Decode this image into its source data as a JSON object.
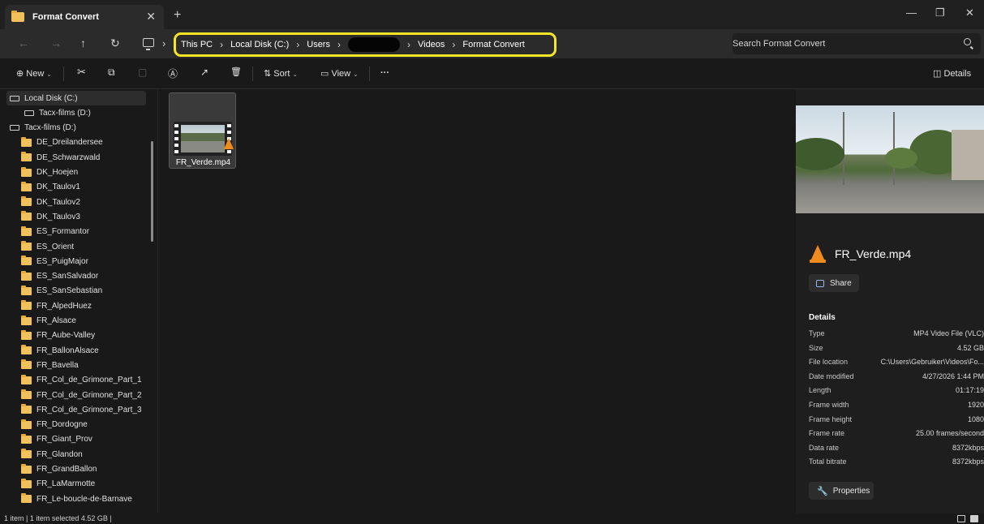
{
  "tab": {
    "title": "Format Convert",
    "close": "✕",
    "add": "+"
  },
  "window_controls": {
    "minimize": "—",
    "maximize": "❐",
    "close": "✕"
  },
  "nav": {
    "back": "←",
    "forward": "→",
    "up": "↑",
    "refresh": "↻",
    "sep": "›"
  },
  "breadcrumb": {
    "items": [
      "This PC",
      "Local Disk (C:)",
      "Users",
      "Videos",
      "Format Convert"
    ],
    "sep": "›"
  },
  "search": {
    "placeholder": "Search Format Convert"
  },
  "commands": {
    "new": "New",
    "sort": "Sort",
    "view": "View",
    "more": "···",
    "details": "Details",
    "cut_icon": "✂",
    "copy_icon": "⧉",
    "paste_icon": "▢",
    "rename_icon": "Ⓐ",
    "share_icon": "↗",
    "delete_icon": "🗑"
  },
  "sidebar": {
    "items": [
      {
        "label": "Local Disk (C:)",
        "kind": "drive"
      },
      {
        "label": "Tacx-films (D:)",
        "kind": "drive"
      },
      {
        "label": "Tacx-films (D:)",
        "kind": "drive"
      },
      {
        "label": "DE_Dreilandersee",
        "kind": "folder"
      },
      {
        "label": "DE_Schwarzwald",
        "kind": "folder"
      },
      {
        "label": "DK_Hoejen",
        "kind": "folder"
      },
      {
        "label": "DK_Taulov1",
        "kind": "folder"
      },
      {
        "label": "DK_Taulov2",
        "kind": "folder"
      },
      {
        "label": "DK_Taulov3",
        "kind": "folder"
      },
      {
        "label": "ES_Formantor",
        "kind": "folder"
      },
      {
        "label": "ES_Orient",
        "kind": "folder"
      },
      {
        "label": "ES_PuigMajor",
        "kind": "folder"
      },
      {
        "label": "ES_SanSalvador",
        "kind": "folder"
      },
      {
        "label": "ES_SanSebastian",
        "kind": "folder"
      },
      {
        "label": "FR_AlpedHuez",
        "kind": "folder"
      },
      {
        "label": "FR_Alsace",
        "kind": "folder"
      },
      {
        "label": "FR_Aube-Valley",
        "kind": "folder"
      },
      {
        "label": "FR_BallonAlsace",
        "kind": "folder"
      },
      {
        "label": "FR_Bavella",
        "kind": "folder"
      },
      {
        "label": "FR_Col_de_Grimone_Part_1",
        "kind": "folder"
      },
      {
        "label": "FR_Col_de_Grimone_Part_2",
        "kind": "folder"
      },
      {
        "label": "FR_Col_de_Grimone_Part_3",
        "kind": "folder"
      },
      {
        "label": "FR_Dordogne",
        "kind": "folder"
      },
      {
        "label": "FR_Giant_Prov",
        "kind": "folder"
      },
      {
        "label": "FR_Glandon",
        "kind": "folder"
      },
      {
        "label": "FR_GrandBallon",
        "kind": "folder"
      },
      {
        "label": "FR_LaMarmotte",
        "kind": "folder"
      },
      {
        "label": "FR_Le-boucle-de-Barnave",
        "kind": "folder"
      }
    ]
  },
  "file": {
    "name": "FR_Verde.mp4"
  },
  "details": {
    "title": "FR_Verde.mp4",
    "share": "Share",
    "section": "Details",
    "properties_button": "Properties",
    "rows": [
      {
        "key": "Type",
        "value": "MP4 Video File (VLC)"
      },
      {
        "key": "Size",
        "value": "4.52 GB"
      },
      {
        "key": "File location",
        "value": "C:\\Users\\Gebruiker\\Videos\\Fo..."
      },
      {
        "key": "Date modified",
        "value": "4/27/2026 1:44 PM"
      },
      {
        "key": "Length",
        "value": "01:17:19"
      },
      {
        "key": "Frame width",
        "value": "1920"
      },
      {
        "key": "Frame height",
        "value": "1080"
      },
      {
        "key": "Frame rate",
        "value": "25.00 frames/second"
      },
      {
        "key": "Data rate",
        "value": "8372kbps"
      },
      {
        "key": "Total bitrate",
        "value": "8372kbps"
      }
    ]
  },
  "status": {
    "text": "1 item  |  1 item selected  4.52 GB  |"
  },
  "colors": {
    "highlight": "#f5e625",
    "folder": "#f1c15b",
    "vlc": "#f08a1c"
  }
}
